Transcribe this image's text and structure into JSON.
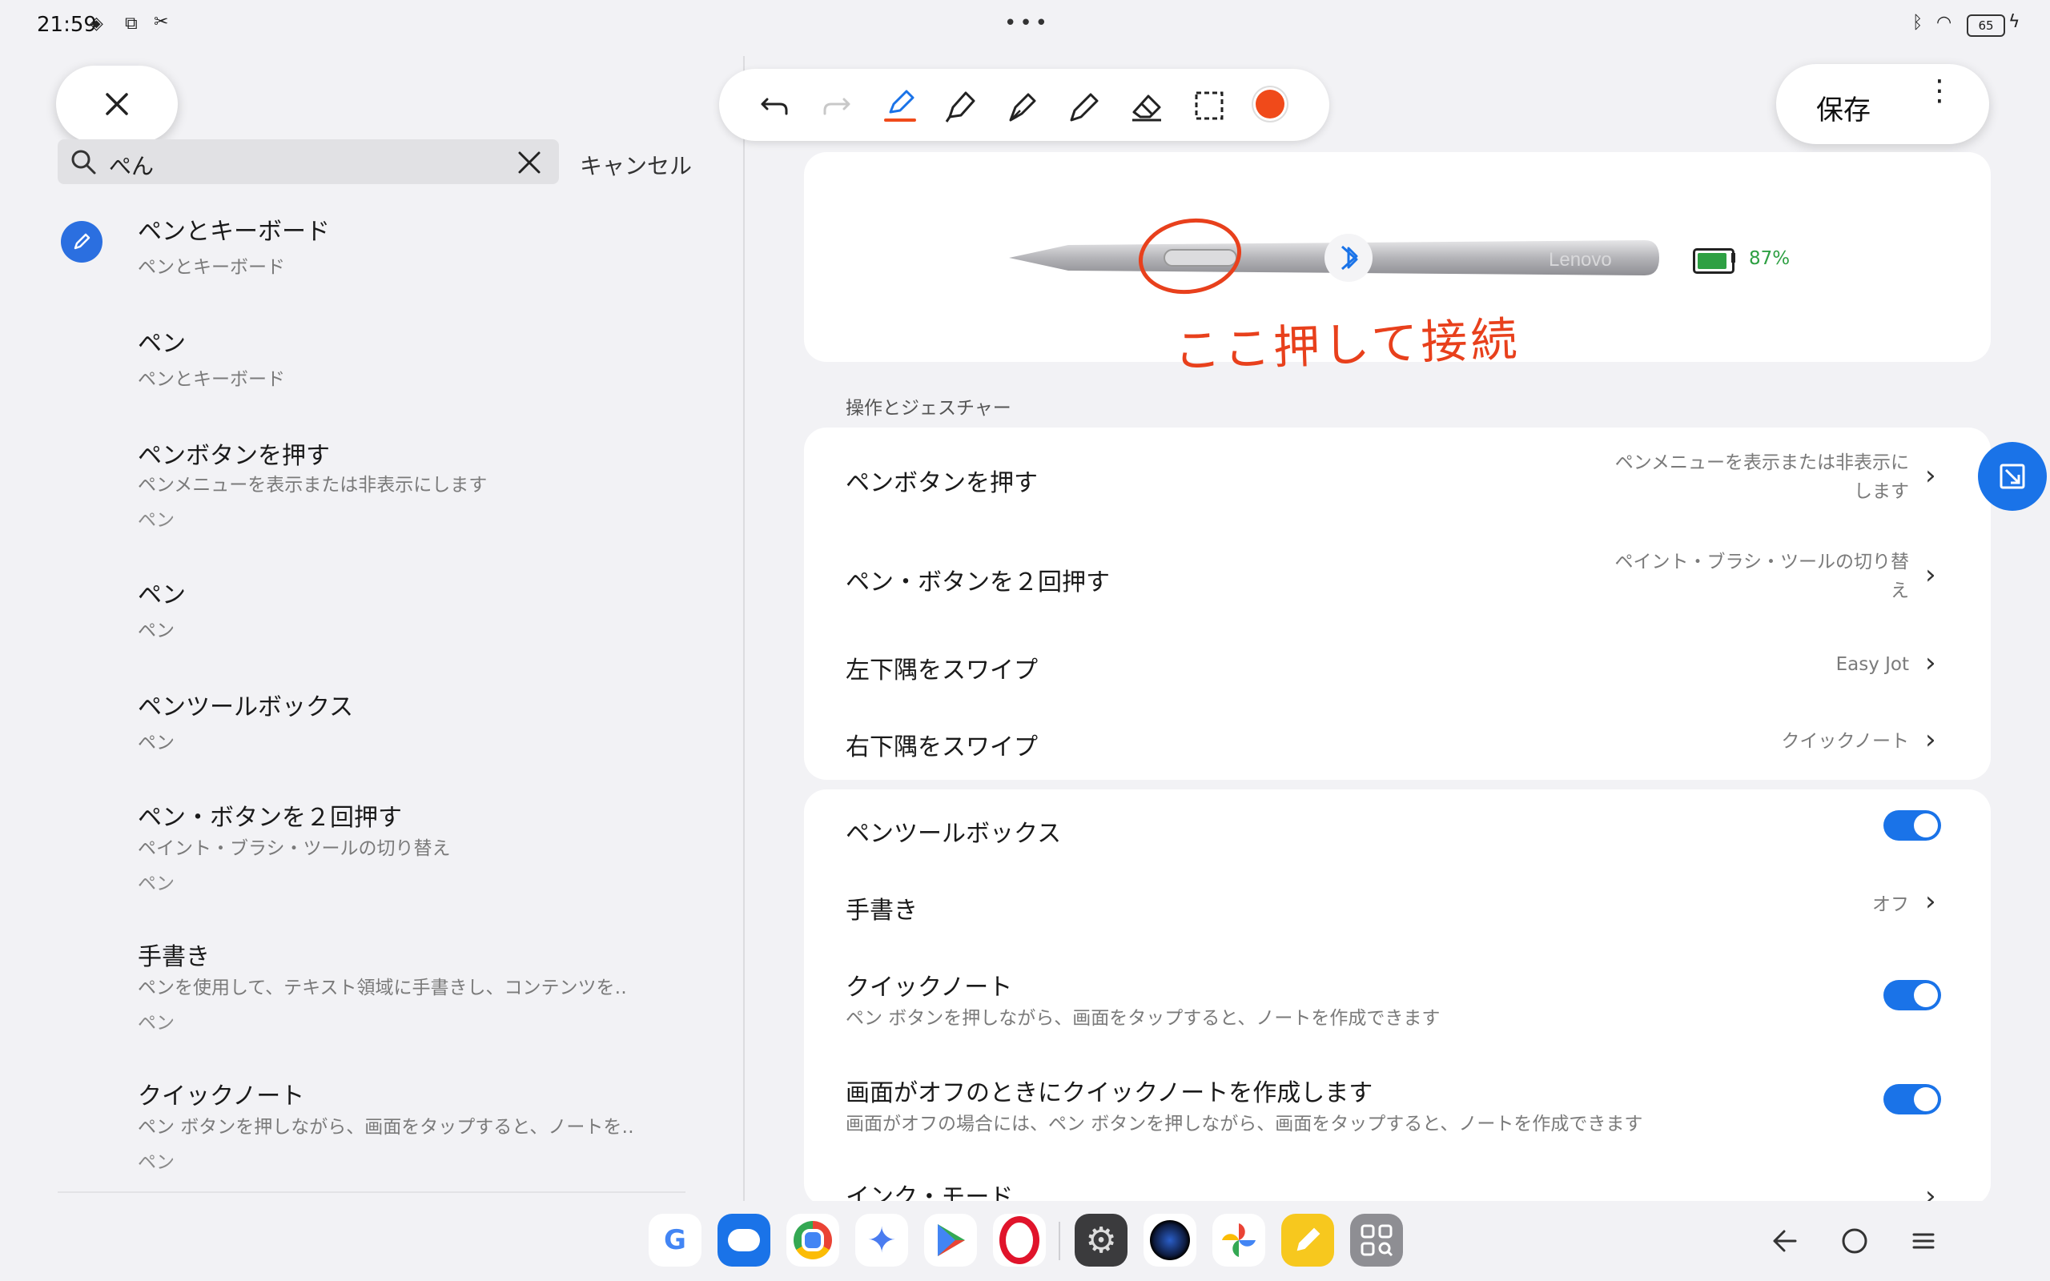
{
  "status_bar": {
    "time": "21:59",
    "battery": "65"
  },
  "left": {
    "search_query": "ぺん",
    "cancel_label": "キャンセル",
    "results": [
      {
        "title": "ペンとキーボード",
        "subtitle": "ペンとキーボード",
        "path": ""
      },
      {
        "title": "ペン",
        "subtitle": "ペンとキーボード",
        "path": ""
      },
      {
        "title": "ペンボタンを押す",
        "subtitle": "ペンメニューを表示または非表示にします",
        "path": "ペン"
      },
      {
        "title": "ペン",
        "subtitle": "ペン",
        "path": ""
      },
      {
        "title": "ペンツールボックス",
        "subtitle": "ペン",
        "path": ""
      },
      {
        "title": "ペン・ボタンを２回押す",
        "subtitle": "ペイント・ブラシ・ツールの切り替え",
        "path": "ペン"
      },
      {
        "title": "手書き",
        "subtitle": "ペンを使用して、テキスト領域に手書きし、コンテンツを‥",
        "path": "ペン"
      },
      {
        "title": "クイックノート",
        "subtitle": "ペン ボタンを押しながら、画面をタップすると、ノートを‥",
        "path": "ペン"
      }
    ]
  },
  "toolbar": {
    "save_label": "保存",
    "color": "#f04a1a"
  },
  "pen_card": {
    "brand": "Lenovo",
    "battery": "87%",
    "annotation": "ここ押して接続"
  },
  "section_header": "操作とジェスチャー",
  "gesture_rows": [
    {
      "title": "ペンボタンを押す",
      "value_line1": "ペンメニューを表示または非表示に",
      "value_line2": "します"
    },
    {
      "title": "ペン・ボタンを２回押す",
      "value_line1": "ペイント・ブラシ・ツールの切り替",
      "value_line2": "え"
    },
    {
      "title": "左下隅をスワイプ",
      "value_line1": "Easy Jot",
      "value_line2": ""
    },
    {
      "title": "右下隅をスワイプ",
      "value_line1": "クイックノート",
      "value_line2": ""
    }
  ],
  "settings_rows": [
    {
      "title": "ペンツールボックス",
      "subtitle": "",
      "value": "",
      "control": "toggle-on"
    },
    {
      "title": "手書き",
      "subtitle": "",
      "value": "オフ",
      "control": "chevron"
    },
    {
      "title": "クイックノート",
      "subtitle": "ペン ボタンを押しながら、画面をタップすると、ノートを作成できます",
      "value": "",
      "control": "toggle-on"
    },
    {
      "title": "画面がオフのときにクイックノートを作成します",
      "subtitle": "画面がオフの場合には、ペン ボタンを押しながら、画面をタップすると、ノートを作成できます",
      "value": "",
      "control": "toggle-on"
    },
    {
      "title": "インク・モード",
      "subtitle": "",
      "value": "",
      "control": "chevron"
    }
  ],
  "colors": {
    "accent": "#1a73e8",
    "battery_green": "#2ea043",
    "annotation_red": "#e8401c"
  },
  "taskbar_apps": [
    "google-icon",
    "messages-icon",
    "chrome-icon",
    "gemini-icon",
    "play-store-icon",
    "opera-icon",
    "settings-icon",
    "camera-icon",
    "photos-icon",
    "notes-icon",
    "app-drawer-icon"
  ]
}
